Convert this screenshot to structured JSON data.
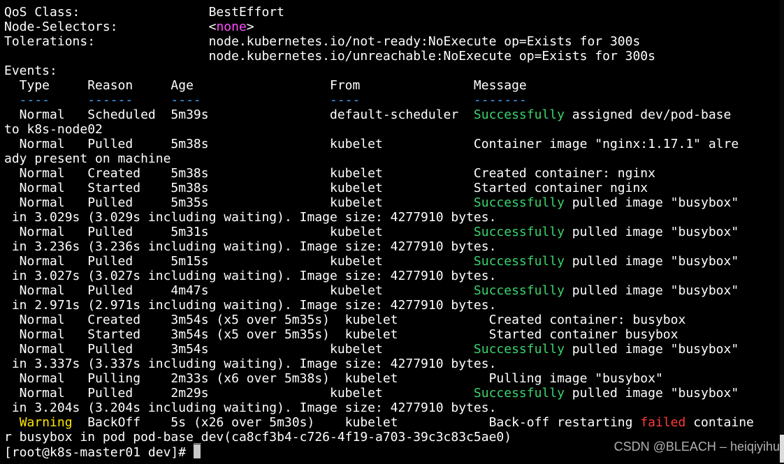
{
  "terminal": {
    "lines": [
      [
        {
          "t": "QoS Class:                 BestEffort",
          "c": "white"
        }
      ],
      [
        {
          "t": "Node-Selectors:            <",
          "c": "white"
        },
        {
          "t": "none",
          "c": "magenta"
        },
        {
          "t": ">",
          "c": "white"
        }
      ],
      [
        {
          "t": "Tolerations:               node.kubernetes.io/not-ready:NoExecute op=Exists for 300s",
          "c": "white"
        }
      ],
      [
        {
          "t": "                           node.kubernetes.io/unreachable:NoExecute op=Exists for 300s",
          "c": "white"
        }
      ],
      [
        {
          "t": "Events:",
          "c": "white"
        }
      ],
      [
        {
          "t": "  Type     Reason     Age                  From               Message",
          "c": "white"
        }
      ],
      [
        {
          "t": "  ----     ------     ----                 ----               -------",
          "c": "blue"
        }
      ],
      [
        {
          "t": "  Normal   Scheduled  5m39s                default-scheduler  ",
          "c": "white"
        },
        {
          "t": "Successfully",
          "c": "green"
        },
        {
          "t": " assigned dev/pod-base",
          "c": "white"
        }
      ],
      [
        {
          "t": "to k8s-node02",
          "c": "white"
        }
      ],
      [
        {
          "t": "  Normal   Pulled     5m38s                kubelet            Container image \"nginx:1.17.1\" alre",
          "c": "white"
        }
      ],
      [
        {
          "t": "ady present on machine",
          "c": "white"
        }
      ],
      [
        {
          "t": "  Normal   Created    5m38s                kubelet            Created container: nginx",
          "c": "white"
        }
      ],
      [
        {
          "t": "  Normal   Started    5m38s                kubelet            Started container nginx",
          "c": "white"
        }
      ],
      [
        {
          "t": "  Normal   Pulled     5m35s                kubelet            ",
          "c": "white"
        },
        {
          "t": "Successfully",
          "c": "green"
        },
        {
          "t": " pulled image \"busybox\"",
          "c": "white"
        }
      ],
      [
        {
          "t": " in 3.029s (3.029s including waiting). Image size: 4277910 bytes.",
          "c": "white"
        }
      ],
      [
        {
          "t": "  Normal   Pulled     5m31s                kubelet            ",
          "c": "white"
        },
        {
          "t": "Successfully",
          "c": "green"
        },
        {
          "t": " pulled image \"busybox\"",
          "c": "white"
        }
      ],
      [
        {
          "t": " in 3.236s (3.236s including waiting). Image size: 4277910 bytes.",
          "c": "white"
        }
      ],
      [
        {
          "t": "  Normal   Pulled     5m15s                kubelet            ",
          "c": "white"
        },
        {
          "t": "Successfully",
          "c": "green"
        },
        {
          "t": " pulled image \"busybox\"",
          "c": "white"
        }
      ],
      [
        {
          "t": " in 3.027s (3.027s including waiting). Image size: 4277910 bytes.",
          "c": "white"
        }
      ],
      [
        {
          "t": "  Normal   Pulled     4m47s                kubelet            ",
          "c": "white"
        },
        {
          "t": "Successfully",
          "c": "green"
        },
        {
          "t": " pulled image \"busybox\"",
          "c": "white"
        }
      ],
      [
        {
          "t": " in 2.971s (2.971s including waiting). Image size: 4277910 bytes.",
          "c": "white"
        }
      ],
      [
        {
          "t": "  Normal   Created    3m54s (x5 over 5m35s)  kubelet            Created container: busybox",
          "c": "white"
        }
      ],
      [
        {
          "t": "  Normal   Started    3m54s (x5 over 5m35s)  kubelet            Started container busybox",
          "c": "white"
        }
      ],
      [
        {
          "t": "  Normal   Pulled     3m54s                kubelet            ",
          "c": "white"
        },
        {
          "t": "Successfully",
          "c": "green"
        },
        {
          "t": " pulled image \"busybox\"",
          "c": "white"
        }
      ],
      [
        {
          "t": " in 3.337s (3.337s including waiting). Image size: 4277910 bytes.",
          "c": "white"
        }
      ],
      [
        {
          "t": "  Normal   Pulling    2m33s (x6 over 5m38s)  kubelet            Pulling image \"busybox\"",
          "c": "white"
        }
      ],
      [
        {
          "t": "  Normal   Pulled     2m29s                kubelet            ",
          "c": "white"
        },
        {
          "t": "Successfully",
          "c": "green"
        },
        {
          "t": " pulled image \"busybox\"",
          "c": "white"
        }
      ],
      [
        {
          "t": " in 3.204s (3.204s including waiting). Image size: 4277910 bytes.",
          "c": "white"
        }
      ],
      [
        {
          "t": "  ",
          "c": "white"
        },
        {
          "t": "Warning",
          "c": "yellow"
        },
        {
          "t": "  BackOff    5s (x26 over 5m30s)    kubelet            Back-off restarting ",
          "c": "white"
        },
        {
          "t": "failed",
          "c": "red"
        },
        {
          "t": " containe",
          "c": "white"
        }
      ],
      [
        {
          "t": "r busybox in pod pod-base_dev(ca8cf3b4-c726-4f19-a703-39c3c83c5ae0)",
          "c": "white"
        }
      ]
    ],
    "prompt": "[root@k8s-master01 dev]# "
  },
  "watermark": "CSDN @BLEACH – heiqiyihu"
}
